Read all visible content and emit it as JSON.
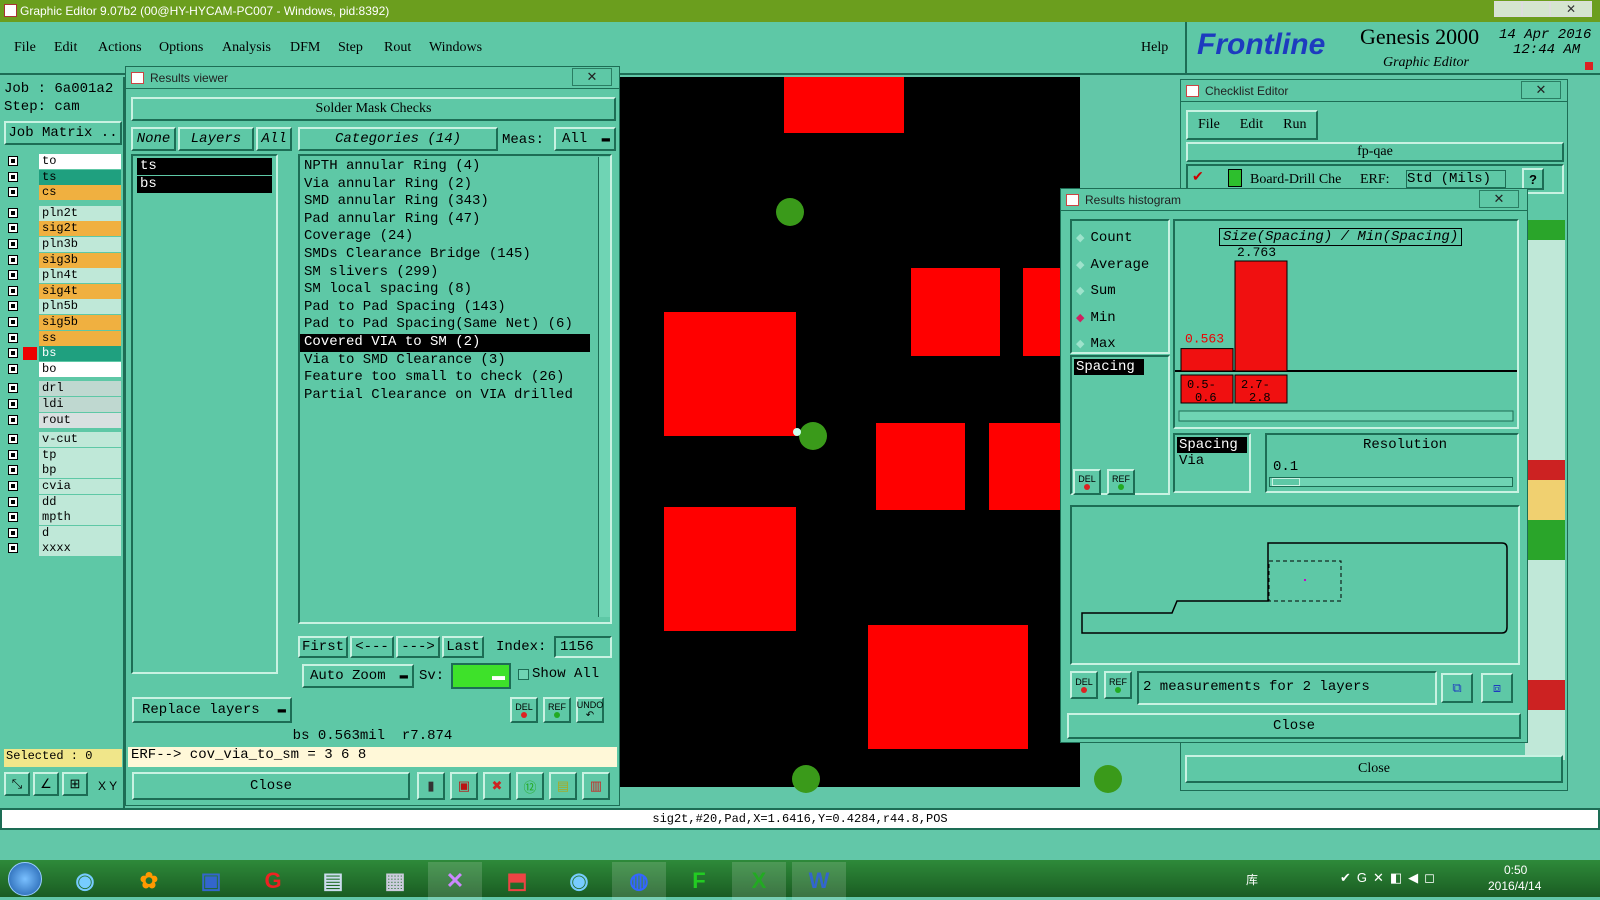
{
  "window": {
    "title": "Graphic Editor 9.07b2 (00@HY-HYCAM-PC007 - Windows, pid:8392)"
  },
  "menu": [
    "File",
    "Edit",
    "Actions",
    "Options",
    "Analysis",
    "DFM",
    "Step",
    "Rout",
    "Windows"
  ],
  "help": "Help",
  "brand": {
    "logo": "Frontline",
    "product": "Genesis 2000",
    "subtitle": "Graphic Editor",
    "date": "14 Apr 2016",
    "time": "12:44 AM"
  },
  "job": {
    "job": "Job : 6a001a2",
    "step": "Step: cam",
    "matrix_btn": "Job Matrix ..",
    "selected": "Selected : 0",
    "xy_label": "X Y"
  },
  "layers": [
    {
      "name": "to",
      "color": "#ffffff",
      "mark": "pencil"
    },
    {
      "name": "ts",
      "color": "#1fa07f"
    },
    {
      "name": "cs",
      "color": "#f0b040"
    },
    {
      "name": "pln2t",
      "color": "#bfe8d8"
    },
    {
      "name": "sig2t",
      "color": "#f0b040"
    },
    {
      "name": "pln3b",
      "color": "#bfe8d8"
    },
    {
      "name": "sig3b",
      "color": "#f0b040"
    },
    {
      "name": "pln4t",
      "color": "#bfe8d8"
    },
    {
      "name": "sig4t",
      "color": "#f0b040"
    },
    {
      "name": "pln5b",
      "color": "#bfe8d8"
    },
    {
      "name": "sig5b",
      "color": "#f0b040"
    },
    {
      "name": "ss",
      "color": "#f0b040"
    },
    {
      "name": "bs",
      "color": "#1fa07f",
      "mark": "active"
    },
    {
      "name": "bo",
      "color": "#ffffff",
      "mark": "pencil"
    },
    {
      "name": "drl",
      "color": "#bfd8d0"
    },
    {
      "name": "ldi",
      "color": "#bfd8d0"
    },
    {
      "name": "rout",
      "color": "#d8e0e0"
    },
    {
      "name": "v-cut",
      "color": "#bfe8d8"
    },
    {
      "name": "tp",
      "color": "#bfe8d8"
    },
    {
      "name": "bp",
      "color": "#bfe8d8"
    },
    {
      "name": "cvia",
      "color": "#bfe8d8"
    },
    {
      "name": "dd",
      "color": "#bfe8d8"
    },
    {
      "name": "mpth",
      "color": "#bfe8d8"
    },
    {
      "name": "d",
      "color": "#bfe8d8"
    },
    {
      "name": "xxxx",
      "color": "#bfe8d8"
    }
  ],
  "results_viewer": {
    "title": "Results viewer",
    "header": "Solder Mask Checks",
    "none_btn": "None",
    "layers_btn": "Layers",
    "all_btn": "All",
    "categories_btn": "Categories (14)",
    "meas_label": "Meas:",
    "meas_value": "All",
    "layer_list": [
      "ts",
      "bs"
    ],
    "categories": [
      "NPTH annular Ring (4)",
      "Via annular Ring (2)",
      "SMD annular Ring (343)",
      "Pad annular Ring (47)",
      "Coverage (24)",
      "SMDs Clearance Bridge (145)",
      "SM slivers (299)",
      "SM local spacing (8)",
      "Pad to Pad Spacing (143)",
      "Pad to Pad Spacing(Same Net) (6)",
      "Covered VIA to SM (2)",
      "Via to SMD Clearance (3)",
      "Feature too small to check (26)",
      "Partial Clearance on VIA drilled"
    ],
    "selected_index": 10,
    "nav": {
      "first": "First",
      "prev": "<---",
      "next": "--->",
      "last": "Last",
      "index_label": "Index:",
      "index_value": "1156"
    },
    "auto_zoom": "Auto Zoom",
    "sv_label": "Sv:",
    "show_all": "Show All",
    "replace_layers": "Replace layers",
    "small_btns": [
      "DEL",
      "REF",
      "UNDO"
    ],
    "status1": "bs 0.563mil  r7.874",
    "status2": "ERF--> cov_via_to_sm = 3 6 8",
    "close": "Close"
  },
  "checklist": {
    "title": "Checklist Editor",
    "menu": [
      "File",
      "Edit",
      "Run"
    ],
    "name": "fp-qae",
    "row_label": "Board-Drill Che",
    "erf_label": "ERF:",
    "erf_value": "Std (Mils)",
    "help": "?",
    "close": "Close"
  },
  "histogram": {
    "title": "Results histogram",
    "options": [
      "Count",
      "Average",
      "Sum",
      "Min",
      "Max"
    ],
    "selected_option": "Min",
    "chart_title": "Size(Spacing) / Min(Spacing)",
    "list1": [
      "Spacing"
    ],
    "list2": [
      "Spacing",
      "Via"
    ],
    "resolution_label": "Resolution",
    "resolution_value": "0.1",
    "status": "2 measurements for 2 layers",
    "close": "Close",
    "btn_del": "DEL",
    "btn_ref": "REF"
  },
  "chart_data": {
    "type": "bar",
    "title": "Size(Spacing) / Min(Spacing)",
    "categories": [
      "0.5-0.6",
      "2.7-2.8"
    ],
    "values": [
      0.563,
      2.763
    ],
    "value_labels": [
      "0.563",
      "2.763"
    ]
  },
  "status_bar": "sig2t,#20,Pad,X=1.6416,Y=0.4284,r44.8,POS",
  "taskbar": {
    "time": "0:50",
    "date": "2016/4/14",
    "tray_label": "库"
  }
}
